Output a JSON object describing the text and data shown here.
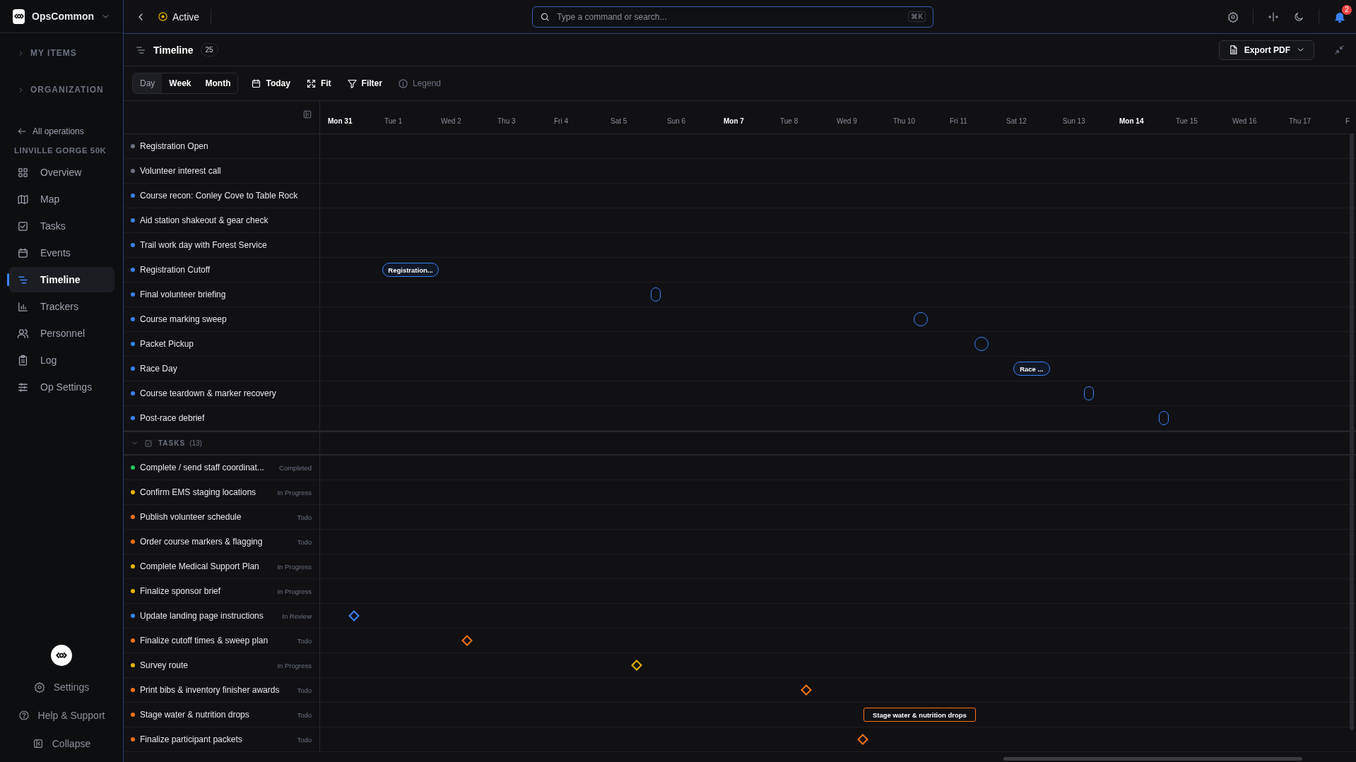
{
  "sidebar": {
    "workspace": "OpsCommon",
    "sections": [
      {
        "label": "MY ITEMS",
        "expanded": false
      },
      {
        "label": "ORGANIZATION",
        "expanded": false
      }
    ],
    "back_link": "All operations",
    "operation": "LINVILLE GORGE 50K",
    "nav": [
      {
        "label": "Overview",
        "selected": false
      },
      {
        "label": "Map",
        "selected": false
      },
      {
        "label": "Tasks",
        "selected": false
      },
      {
        "label": "Events",
        "selected": false
      },
      {
        "label": "Timeline",
        "selected": true
      },
      {
        "label": "Trackers",
        "selected": false
      },
      {
        "label": "Personnel",
        "selected": false
      },
      {
        "label": "Log",
        "selected": false
      },
      {
        "label": "Op Settings",
        "selected": false
      }
    ],
    "footer": [
      {
        "label": "Settings"
      },
      {
        "label": "Help & Support"
      },
      {
        "label": "Collapse"
      }
    ]
  },
  "topbar": {
    "status": "Active",
    "search": {
      "placeholder": "Type a command or search...",
      "shortcut": "⌘K"
    },
    "notifications": "2"
  },
  "header": {
    "title": "Timeline",
    "count": "25",
    "export": "Export PDF"
  },
  "toolbar": {
    "views": [
      {
        "label": "Day",
        "selected": true
      },
      {
        "label": "Week",
        "selected": false
      },
      {
        "label": "Month",
        "selected": false
      }
    ],
    "actions": [
      {
        "label": "Today",
        "disabled": false
      },
      {
        "label": "Fit",
        "disabled": false
      },
      {
        "label": "Filter",
        "disabled": false
      },
      {
        "label": "Legend",
        "disabled": true
      }
    ]
  },
  "timeline": {
    "days": [
      {
        "label": "Mon 31",
        "week_start": true
      },
      {
        "label": "Tue 1",
        "week_start": false
      },
      {
        "label": "Wed 2",
        "week_start": false
      },
      {
        "label": "Thu 3",
        "week_start": false
      },
      {
        "label": "Fri 4",
        "week_start": false
      },
      {
        "label": "Sat 5",
        "week_start": false
      },
      {
        "label": "Sun 6",
        "week_start": false
      },
      {
        "label": "Mon 7",
        "week_start": true
      },
      {
        "label": "Tue 8",
        "week_start": false
      },
      {
        "label": "Wed 9",
        "week_start": false
      },
      {
        "label": "Thu 10",
        "week_start": false
      },
      {
        "label": "Fri 11",
        "week_start": false
      },
      {
        "label": "Sat 12",
        "week_start": false
      },
      {
        "label": "Sun 13",
        "week_start": false
      },
      {
        "label": "Mon 14",
        "week_start": true
      },
      {
        "label": "Tue 15",
        "week_start": false
      },
      {
        "label": "Wed 16",
        "week_start": false
      },
      {
        "label": "Thu 17",
        "week_start": false
      },
      {
        "label": "F",
        "week_start": false
      }
    ],
    "events": [
      {
        "name": "Registration Open",
        "color": "#6b7280"
      },
      {
        "name": "Volunteer interest call",
        "color": "#6b7280"
      },
      {
        "name": "Course recon: Conley Cove to Table Rock",
        "color": "#3b82f6"
      },
      {
        "name": "Aid station shakeout & gear check",
        "color": "#3b82f6"
      },
      {
        "name": "Trail work day with Forest Service",
        "color": "#3b82f6"
      },
      {
        "name": "Registration Cutoff",
        "color": "#3b82f6",
        "marker": {
          "kind": "pill",
          "label": "Registration..."
        }
      },
      {
        "name": "Final volunteer briefing",
        "color": "#3b82f6",
        "marker": {
          "kind": "slot"
        }
      },
      {
        "name": "Course marking sweep",
        "color": "#3b82f6",
        "marker": {
          "kind": "circle"
        }
      },
      {
        "name": "Packet Pickup",
        "color": "#3b82f6",
        "marker": {
          "kind": "circle"
        }
      },
      {
        "name": "Race Day",
        "color": "#3b82f6",
        "marker": {
          "kind": "pill",
          "label": "Race ..."
        }
      },
      {
        "name": "Course teardown & marker recovery",
        "color": "#3b82f6",
        "marker": {
          "kind": "slot"
        }
      },
      {
        "name": "Post-race debrief",
        "color": "#3b82f6",
        "marker": {
          "kind": "slot"
        }
      }
    ],
    "tasks_group": {
      "label": "TASKS",
      "count": "(13)",
      "expanded": true
    },
    "tasks": [
      {
        "name": "Complete / send staff coordinat...",
        "status": "Completed",
        "color": "#22c55e"
      },
      {
        "name": "Confirm EMS staging locations",
        "status": "In Progress",
        "color": "#eab308"
      },
      {
        "name": "Publish volunteer schedule",
        "status": "Todo",
        "color": "#f97316"
      },
      {
        "name": "Order course markers & flagging",
        "status": "Todo",
        "color": "#f97316"
      },
      {
        "name": "Complete Medical Support Plan",
        "status": "In Progress",
        "color": "#eab308"
      },
      {
        "name": "Finalize sponsor brief",
        "status": "In Progress",
        "color": "#eab308"
      },
      {
        "name": "Update landing page instructions",
        "status": "In Review",
        "color": "#3b82f6",
        "marker": {
          "kind": "diamond"
        }
      },
      {
        "name": "Finalize cutoff times & sweep plan",
        "status": "Todo",
        "color": "#f97316",
        "marker": {
          "kind": "diamond"
        }
      },
      {
        "name": "Survey route",
        "status": "In Progress",
        "color": "#eab308",
        "marker": {
          "kind": "diamond"
        }
      },
      {
        "name": "Print bibs & inventory finisher awards",
        "status": "Todo",
        "color": "#f97316",
        "marker": {
          "kind": "diamond"
        }
      },
      {
        "name": "Stage water & nutrition drops",
        "status": "Todo",
        "color": "#f97316",
        "marker": {
          "kind": "box",
          "label": "Stage water & nutrition drops"
        }
      },
      {
        "name": "Finalize participant packets",
        "status": "Todo",
        "color": "#f97316",
        "marker": {
          "kind": "diamond"
        }
      }
    ]
  }
}
